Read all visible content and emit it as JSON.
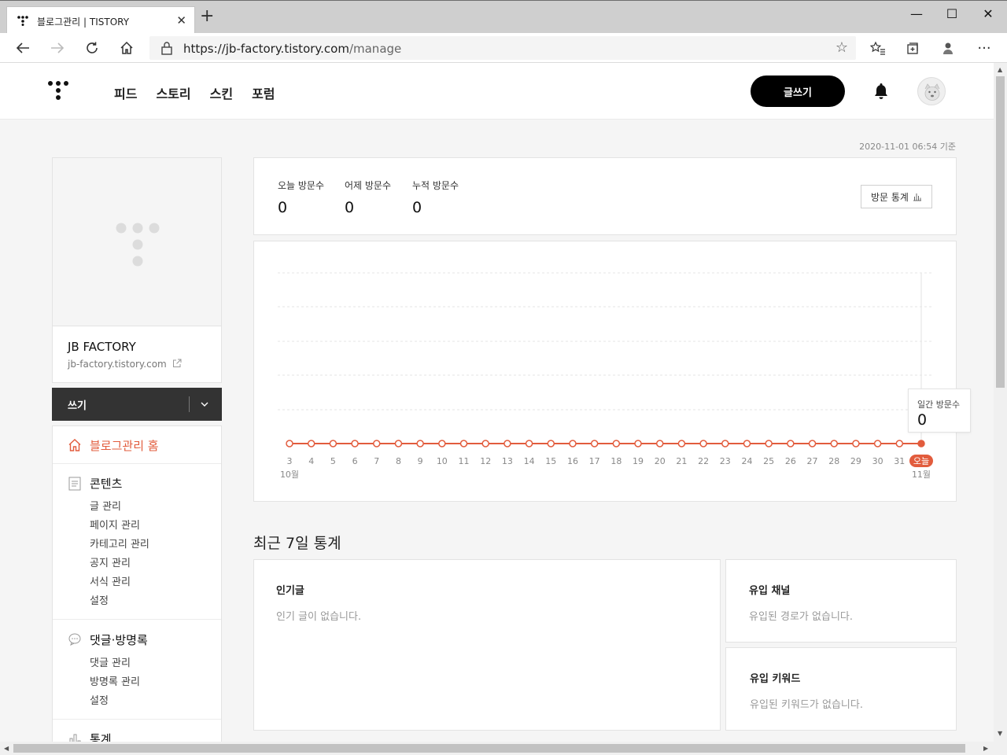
{
  "browser": {
    "tab_title": "블로그관리 | TISTORY",
    "url_host": "https://jb-factory.tistory.com",
    "url_path": "/manage"
  },
  "gnb": {
    "menu": [
      "피드",
      "스토리",
      "스킨",
      "포럼"
    ],
    "write_label": "글쓰기"
  },
  "timestamp": "2020-11-01 06:54 기준",
  "profile": {
    "blog_name": "JB FACTORY",
    "blog_url": "jb-factory.tistory.com"
  },
  "writebar": {
    "label": "쓰기"
  },
  "sidebar": {
    "home_label": "블로그관리 홈",
    "groups": [
      {
        "title": "콘텐츠",
        "icon": "document-icon",
        "items": [
          "글 관리",
          "페이지 관리",
          "카테고리 관리",
          "공지 관리",
          "서식 관리",
          "설정"
        ]
      },
      {
        "title": "댓글·방명록",
        "icon": "speech-bubble-icon",
        "items": [
          "댓글 관리",
          "방명록 관리",
          "설정"
        ]
      },
      {
        "title": "통계",
        "icon": "bar-chart-icon",
        "items": []
      }
    ]
  },
  "visitors": {
    "today_label": "오늘 방문수",
    "today": "0",
    "yesterday_label": "어제 방문수",
    "yesterday": "0",
    "total_label": "누적 방문수",
    "total": "0",
    "stats_button": "방문 통계"
  },
  "chart_data": {
    "type": "line",
    "x": [
      "3",
      "4",
      "5",
      "6",
      "7",
      "8",
      "9",
      "10",
      "11",
      "12",
      "13",
      "14",
      "15",
      "16",
      "17",
      "18",
      "19",
      "20",
      "21",
      "22",
      "23",
      "24",
      "25",
      "26",
      "27",
      "28",
      "29",
      "30",
      "31",
      "오늘"
    ],
    "month_labels": {
      "start": "10월",
      "end": "11월"
    },
    "series": [
      {
        "values": [
          0,
          0,
          0,
          0,
          0,
          0,
          0,
          0,
          0,
          0,
          0,
          0,
          0,
          0,
          0,
          0,
          0,
          0,
          0,
          0,
          0,
          0,
          0,
          0,
          0,
          0,
          0,
          0,
          0,
          0
        ]
      }
    ],
    "color": "#e25c3d",
    "grid": true,
    "tooltip_label": "일간 방문수",
    "tooltip_value": "0"
  },
  "recent": {
    "title": "최근 7일 통계",
    "popular_title": "인기글",
    "popular_empty": "인기 글이 없습니다.",
    "channel_title": "유입 채널",
    "channel_empty": "유입된 경로가 없습니다.",
    "keyword_title": "유입 키워드",
    "keyword_empty": "유입된 키워드가 없습니다."
  }
}
